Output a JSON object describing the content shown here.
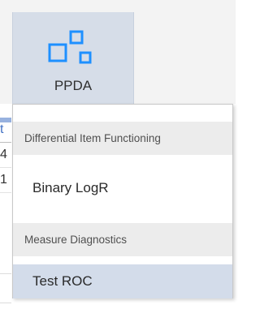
{
  "ribbon": {
    "ppda_button": {
      "label": "PPDA",
      "icon": "multi-square-icon",
      "icon_color": "#1e90ff"
    }
  },
  "background_grid": {
    "row_fragments": [
      "t",
      "4",
      "1"
    ]
  },
  "dropdown": {
    "sections": [
      {
        "header": "Differential Item Functioning",
        "items": [
          {
            "label": "Binary LogR"
          }
        ]
      },
      {
        "header": "Measure Diagnostics",
        "items": [
          {
            "label": "Test ROC",
            "highlighted": true
          }
        ]
      }
    ],
    "highlight_color": "#d3dcea"
  }
}
